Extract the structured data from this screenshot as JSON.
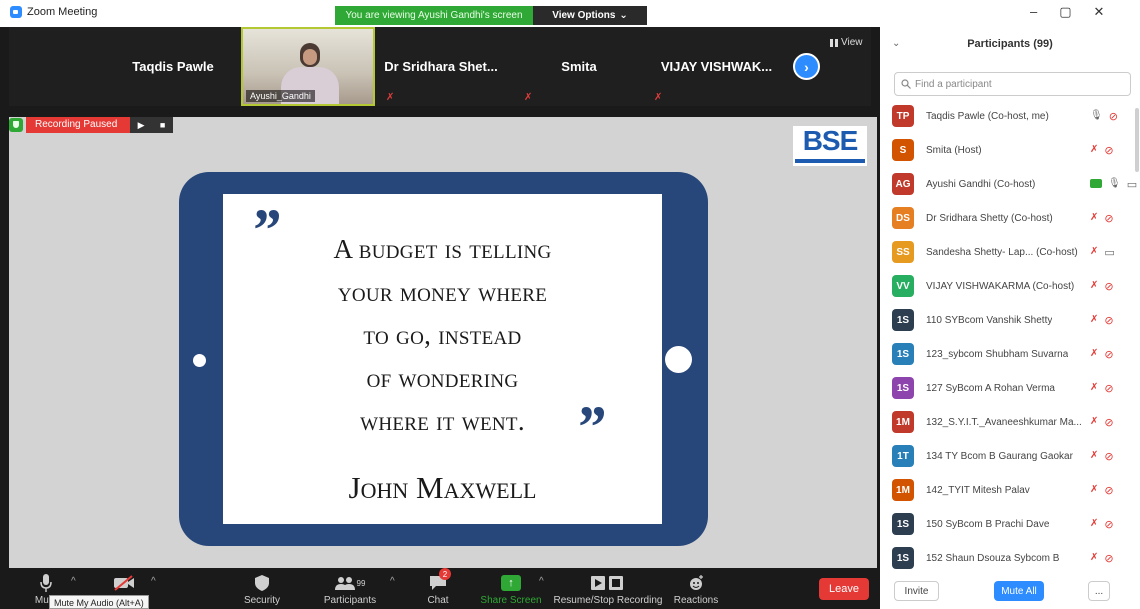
{
  "window": {
    "title": "Zoom Meeting",
    "viewing_banner": "You are viewing Ayushi Gandhi's screen",
    "view_options": "View Options",
    "view_options_caret": "⌄",
    "controls": [
      "–",
      "▢",
      "✕"
    ]
  },
  "strip": {
    "tiles": [
      {
        "name": "Taqdis Pawle"
      },
      {
        "name": "Dr Sridhara Shet..."
      },
      {
        "name": "Smita"
      },
      {
        "name": "VIJAY VISHWAK..."
      }
    ],
    "video_name": "Ayushi_Gandhi",
    "view_label": "View",
    "next_icon": "chevron-right"
  },
  "recording": {
    "label": "Recording Paused",
    "play": "▶",
    "stop": "■"
  },
  "share": {
    "logo": "BSE",
    "quote_lines": [
      "A budget is telling",
      "your money where",
      "to go, instead",
      "of wondering",
      "where it went."
    ],
    "author": "John Maxwell",
    "open_quote": "”",
    "close_quote": "”"
  },
  "toolbar": {
    "mute_label": "Mute",
    "mute_tooltip": "Mute My Audio (Alt+A)",
    "video_label": "",
    "security_label": "Security",
    "participants_label": "Participants",
    "participants_count": "99",
    "chat_label": "Chat",
    "chat_badge": "2",
    "share_label": "Share Screen",
    "record_label": "Resume/Stop Recording",
    "reactions_label": "Reactions",
    "leave_label": "Leave"
  },
  "panel": {
    "title": "Participants (99)",
    "search_placeholder": "Find a participant",
    "participants": [
      {
        "initials": "TP",
        "name": "Taqdis Pawle (Co-host, me)",
        "color": "#c0392b",
        "mic": "on",
        "cam": "off"
      },
      {
        "initials": "S",
        "name": "Smita (Host)",
        "color": "#d35400",
        "mic": "off",
        "cam": "off"
      },
      {
        "initials": "AG",
        "name": "Ayushi Gandhi (Co-host)",
        "color": "#c0392b",
        "mic": "on",
        "cam": "on",
        "sharing": true
      },
      {
        "initials": "DS",
        "name": "Dr Sridhara Shetty (Co-host)",
        "color": "#e67e22",
        "mic": "off",
        "cam": "off"
      },
      {
        "initials": "SS",
        "name": "Sandesha Shetty- Lap... (Co-host)",
        "color": "#e69a20",
        "mic": "off",
        "cam": "on"
      },
      {
        "initials": "VV",
        "name": "VIJAY VISHWAKARMA (Co-host)",
        "color": "#27ae60",
        "mic": "off",
        "cam": "off"
      },
      {
        "initials": "1S",
        "name": "110 SYBcom Vanshik Shetty",
        "color": "#2c3e50",
        "mic": "off",
        "cam": "off"
      },
      {
        "initials": "1S",
        "name": "123_sybcom Shubham Suvarna",
        "color": "#2980b9",
        "mic": "off",
        "cam": "off"
      },
      {
        "initials": "1S",
        "name": "127 SyBcom A Rohan Verma",
        "color": "#8e44ad",
        "mic": "off",
        "cam": "off"
      },
      {
        "initials": "1M",
        "name": "132_S.Y.I.T._Avaneeshkumar Ma...",
        "color": "#c0392b",
        "mic": "off",
        "cam": "off"
      },
      {
        "initials": "1T",
        "name": "134 TY Bcom B Gaurang Gaokar",
        "color": "#2980b9",
        "mic": "off",
        "cam": "off"
      },
      {
        "initials": "1M",
        "name": "142_TYIT Mitesh Palav",
        "color": "#d35400",
        "mic": "off",
        "cam": "off"
      },
      {
        "initials": "1S",
        "name": "150 SyBcom B Prachi Dave",
        "color": "#2c3e50",
        "mic": "off",
        "cam": "off"
      },
      {
        "initials": "1S",
        "name": "152 Shaun Dsouza Sybcom B",
        "color": "#2c3e50",
        "mic": "off",
        "cam": "off"
      }
    ],
    "invite_label": "Invite",
    "mute_all_label": "Mute All",
    "more_label": "..."
  }
}
